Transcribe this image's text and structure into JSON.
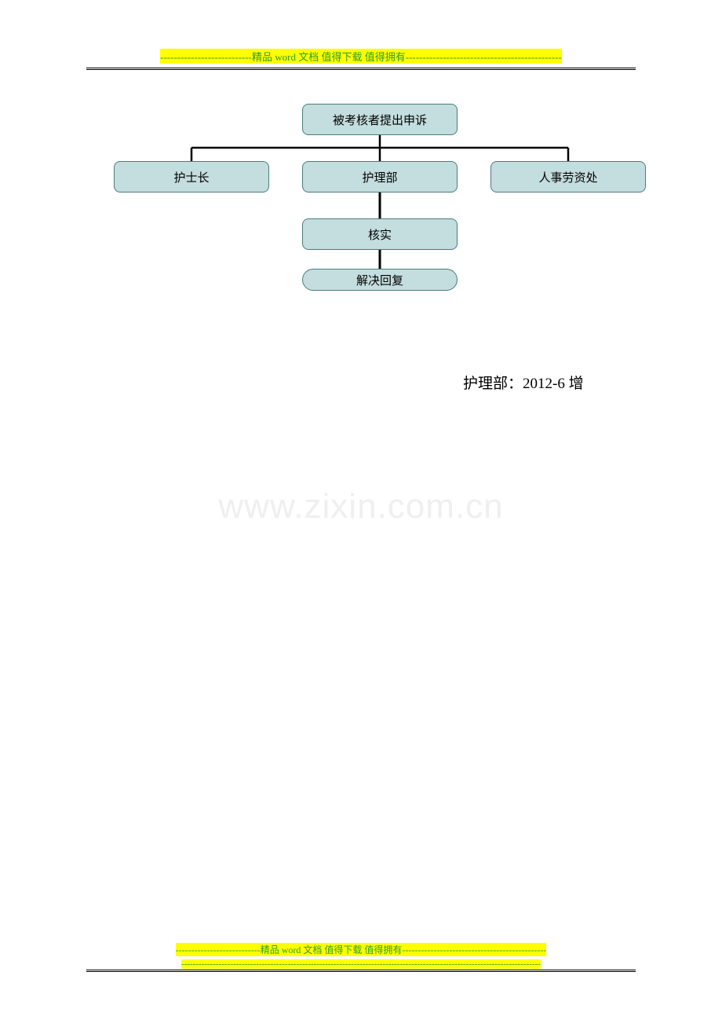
{
  "header": {
    "dashes_left": "---------------------------",
    "text": "精品 word 文档  值得下载  值得拥有",
    "dashes_right": "----------------------------------------------"
  },
  "footer": {
    "dashes_left": "---------------------------",
    "text": "精品 word 文档  值得下载  值得拥有",
    "dashes_right": "----------------------------------------------",
    "line2": "-----------------------------------------------------------------------------------------------------------------------------"
  },
  "flow": {
    "top": "被考核者提出申诉",
    "level1": {
      "a": "护士长",
      "b": "护理部",
      "c": "人事劳资处"
    },
    "level2": "核实",
    "level3": "解决回复"
  },
  "attribution": "护理部：2012-6 增",
  "watermark": "www.zixin.com.cn"
}
